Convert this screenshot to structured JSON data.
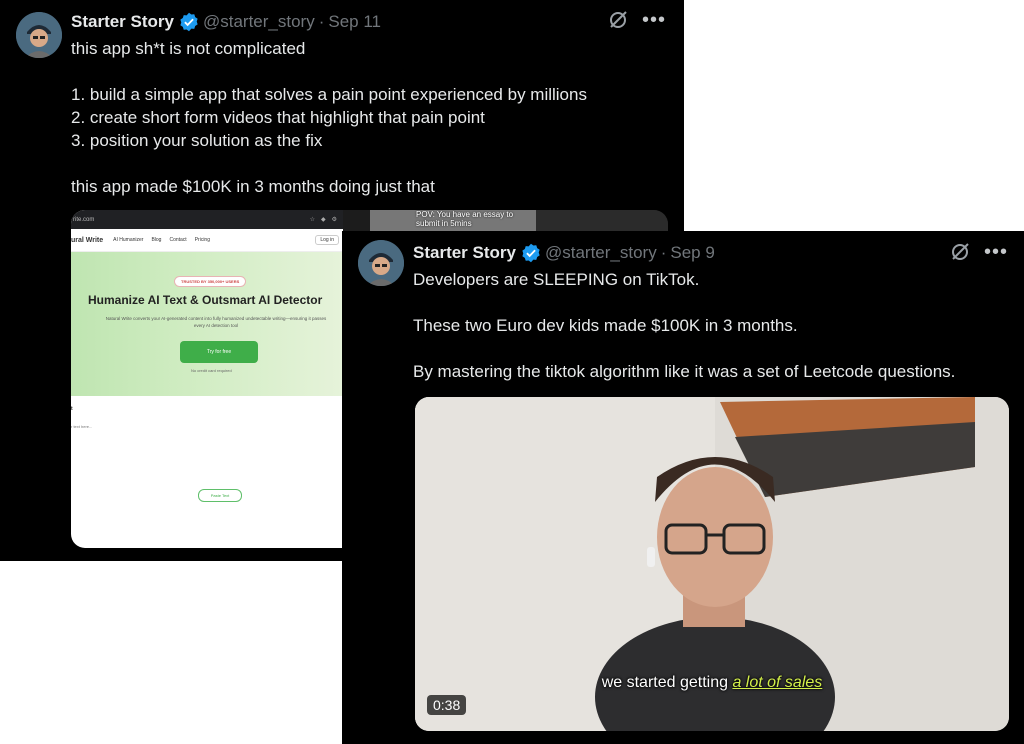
{
  "tweets": [
    {
      "author_name": "Starter Story",
      "handle": "@starter_story",
      "separator": "·",
      "date": "Sep 11",
      "lines": [
        "this app sh*t is not complicated",
        "",
        "1. build a simple app that solves a pain point experienced by millions",
        "2. create short form videos that highlight that pain point",
        "3. position your solution as the fix",
        "",
        "this app made $100K in 3 months doing just that"
      ],
      "media": {
        "browser_url": "rite.com",
        "site": {
          "brand": "ural Write",
          "nav": [
            "AI Humanizer",
            "Blog",
            "Contact",
            "Pricing"
          ],
          "login": "Log in",
          "badge": "TRUSTED BY 350,000+ USERS",
          "title": "Humanize AI Text & Outsmart AI Detector",
          "subtitle": "Natural Write converts your AI-generated content into fully humanized undetectable writing—ensuring it passes every AI detection tool",
          "cta": "Try for free",
          "cta_note": "No credit card required",
          "lower_label": "t",
          "placeholder": "r text here...",
          "paste_button": "Paste Text"
        },
        "video_caption": "POV: You have an essay to submit in 5mins"
      }
    },
    {
      "author_name": "Starter Story",
      "handle": "@starter_story",
      "separator": "·",
      "date": "Sep 9",
      "lines": [
        "Developers are SLEEPING on TikTok.",
        "",
        "These two Euro dev kids made $100K in 3 months.",
        "",
        "By mastering the tiktok algorithm like it was a set of Leetcode questions."
      ],
      "video": {
        "caption_prefix": "we started getting",
        "caption_highlight": "a lot of sales",
        "duration": "0:38"
      }
    }
  ],
  "colors": {
    "background": "#000000",
    "verified": "#1d9bf0",
    "secondary_text": "#71767b"
  },
  "icons": [
    "verified-badge-icon",
    "grok-icon",
    "more-icon"
  ]
}
